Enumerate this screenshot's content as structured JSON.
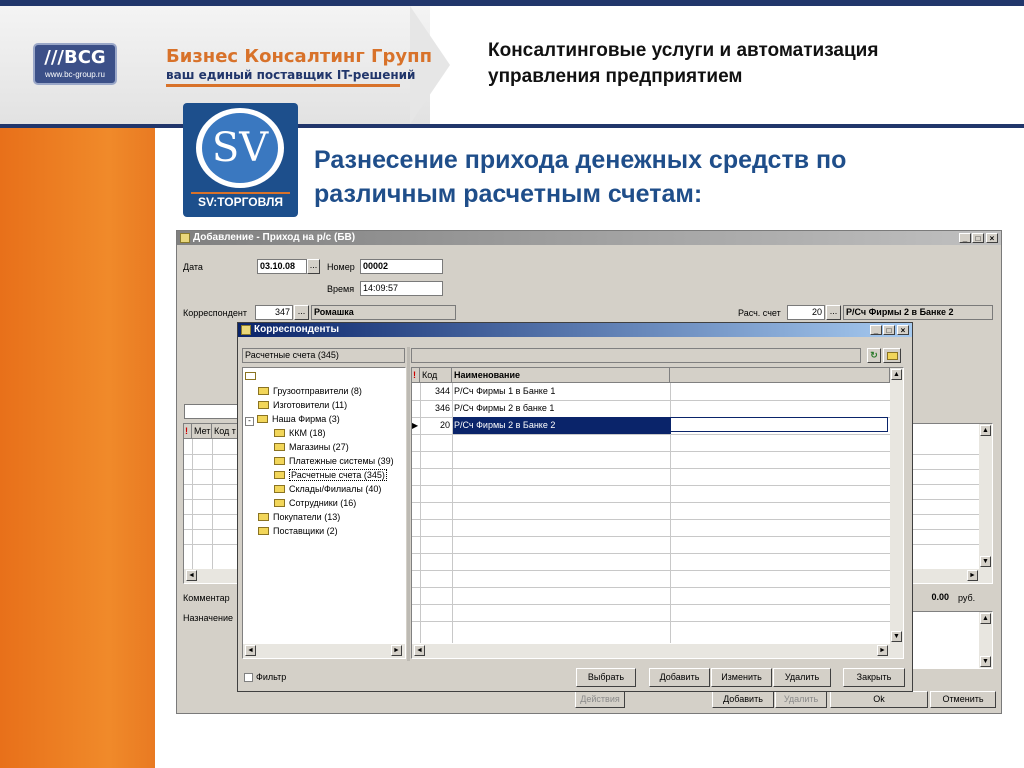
{
  "slide": {
    "company_name": "Бизнес Консалтинг Групп",
    "company_slogan": "ваш единый поставщик IT-решений",
    "logo_text": "///BCG",
    "logo_url": "www.bc-group.ru",
    "header_title_line1": "Консалтинговые услуги и автоматизация",
    "header_title_line2": "управления предприятием",
    "product_logo_text": "SV",
    "product_logo_caption": "SV:ТОРГОВЛЯ",
    "title_line1": "Разнесение прихода денежных средств по",
    "title_line2": "различным расчетным счетам:"
  },
  "main_window": {
    "title": "Добавление - Приход на р/с  (БВ)",
    "labels": {
      "date": "Дата",
      "number": "Номер",
      "time": "Время",
      "correspondent": "Корреспондент",
      "account": "Расч. счет",
      "comment": "Комментар",
      "purpose": "Назначение",
      "currency": "руб."
    },
    "values": {
      "date": "03.10.08",
      "number": "00002",
      "time": "14:09:57",
      "correspondent_code": "347",
      "correspondent_name": "Ромашка",
      "account_code": "20",
      "account_name": "Р/Сч Фирмы 2 в Банке 2",
      "amount": "0.00"
    },
    "grid_headers": [
      "Мет",
      "Код т"
    ],
    "buttons": {
      "actions": "Действия",
      "add": "Добавить",
      "delete": "Удалить",
      "ok": "Ok",
      "cancel": "Отменить"
    },
    "ellipsis": "..."
  },
  "dialog": {
    "title": "Корреспонденты",
    "tree_header": "Расчетные счета  (345)",
    "tree": [
      {
        "label": "Грузоотправители  (8)",
        "level": 1
      },
      {
        "label": "Изготовители  (11)",
        "level": 1
      },
      {
        "label": "Наша Фирма  (3)",
        "level": 1
      },
      {
        "label": "ККМ  (18)",
        "level": 2
      },
      {
        "label": "Магазины  (27)",
        "level": 2
      },
      {
        "label": "Платежные системы  (39)",
        "level": 2
      },
      {
        "label": "Расчетные счета  (345)",
        "level": 2,
        "selected": true
      },
      {
        "label": "Склады/Филиалы  (40)",
        "level": 2
      },
      {
        "label": "Сотрудники  (16)",
        "level": 2
      },
      {
        "label": "Покупатели  (13)",
        "level": 1
      },
      {
        "label": "Поставщики  (2)",
        "level": 1
      }
    ],
    "grid_headers": {
      "flag": "!",
      "code": "Код",
      "name": "Наименование"
    },
    "rows": [
      {
        "code": "344",
        "name": "Р/Сч Фирмы 1 в Банке 1"
      },
      {
        "code": "346",
        "name": "Р/Сч Фирмы 2 в банке 1"
      },
      {
        "code": "20",
        "name": "Р/Сч Фирмы 2 в Банке 2",
        "selected": true
      }
    ],
    "filter_label": "Фильтр",
    "buttons": {
      "select": "Выбрать",
      "add": "Добавить",
      "edit": "Изменить",
      "delete": "Удалить",
      "close": "Закрыть"
    }
  },
  "colors": {
    "orange": "#e8701a",
    "navy": "#21366b",
    "title_blue": "#1f4e8a",
    "selection": "#0a246a"
  }
}
